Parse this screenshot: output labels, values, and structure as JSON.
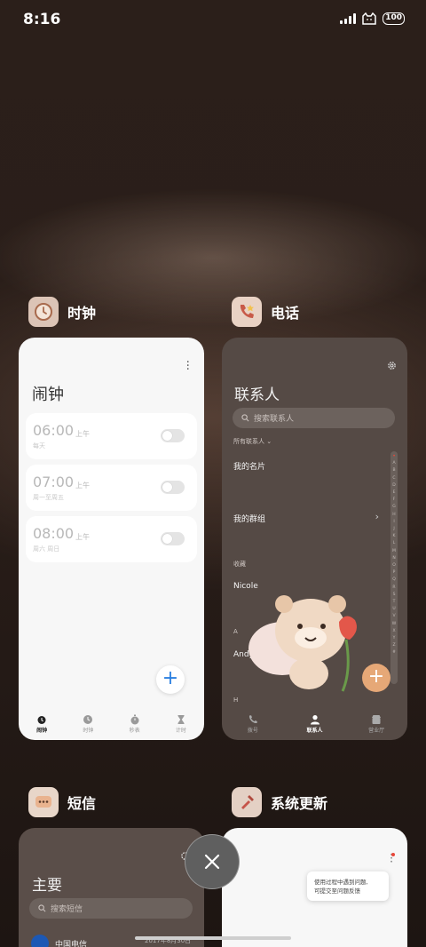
{
  "status_bar": {
    "time": "8:16",
    "battery": "100"
  },
  "apps": {
    "clock": {
      "name": "时钟",
      "title": "闹钟",
      "alarms": [
        {
          "time": "06:00",
          "ampm": "上午",
          "repeat": "每天"
        },
        {
          "time": "07:00",
          "ampm": "上午",
          "repeat": "周一至周五"
        },
        {
          "time": "08:00",
          "ampm": "上午",
          "repeat": "周六 周日"
        }
      ],
      "nav": [
        "闹钟",
        "时钟",
        "秒表",
        "计时"
      ],
      "icon_color": "#c98a6a"
    },
    "phone": {
      "name": "电话",
      "title": "联系人",
      "search_placeholder": "搜索联系人",
      "all_contacts": "所有联系人",
      "my_card": "我的名片",
      "my_groups": "我的群组",
      "favorites": "收藏",
      "favorite_contact": "Nicole",
      "section_a": "A",
      "contact_a": "Andy",
      "section_h": "H",
      "index": [
        "A",
        "B",
        "C",
        "D",
        "E",
        "F",
        "G",
        "H",
        "I",
        "J",
        "K",
        "L",
        "M",
        "N",
        "O",
        "P",
        "Q",
        "R",
        "S",
        "T",
        "U",
        "V",
        "W",
        "X",
        "Y",
        "Z",
        "#"
      ],
      "nav": [
        "拨号",
        "联系人",
        "营业厅"
      ],
      "fab_color": "#e6a877"
    },
    "sms": {
      "name": "短信",
      "title": "主要",
      "search_placeholder": "搜索短信",
      "sender": "中国电信",
      "date": "2017年8月30日"
    },
    "update": {
      "name": "系统更新",
      "tooltip_line1": "使用过程中遇到问题,",
      "tooltip_line2": "可提交至问题反馈"
    }
  }
}
